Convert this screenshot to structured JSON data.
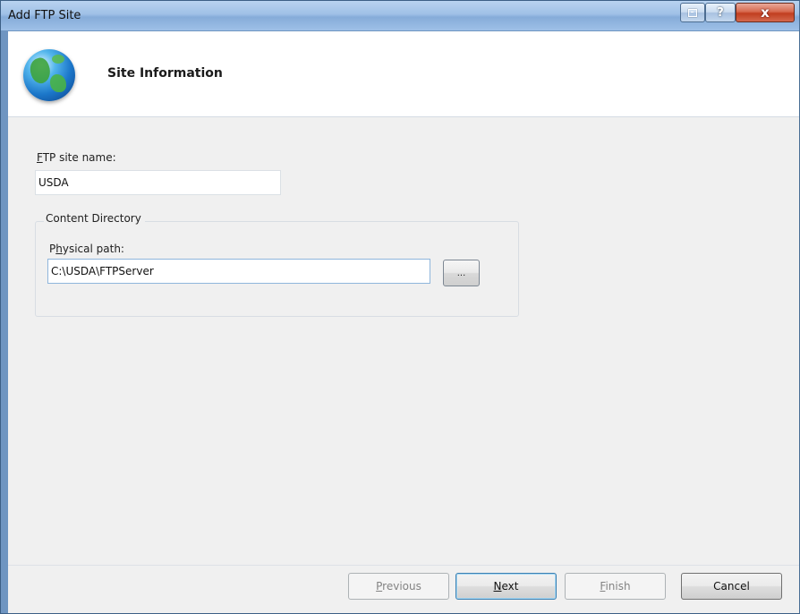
{
  "window": {
    "title": "Add FTP Site",
    "controls": {
      "restore_icon": "restore-icon",
      "help_glyph": "?",
      "close_glyph": "x"
    }
  },
  "header": {
    "title": "Site Information",
    "icon": "globe-icon"
  },
  "form": {
    "site_name": {
      "label_mnemonic": "F",
      "label_rest": "TP site name:",
      "value": "USDA"
    },
    "content_directory": {
      "legend": "Content Directory",
      "physical_path": {
        "label_pre": "P",
        "label_mnemonic": "h",
        "label_rest": "ysical path:",
        "value": "C:\\USDA\\FTPServer",
        "browse_label": "..."
      }
    }
  },
  "footer": {
    "previous": {
      "mnemonic": "P",
      "rest": "revious",
      "enabled": false
    },
    "next": {
      "mnemonic": "N",
      "rest": "ext",
      "enabled": true
    },
    "finish": {
      "mnemonic": "F",
      "rest": "inish",
      "enabled": false
    },
    "cancel": {
      "label": "Cancel",
      "enabled": true
    }
  },
  "colors": {
    "titlebar": "#9fc0e6",
    "close_button": "#c13e1f",
    "dialog_body": "#f0f0f0",
    "header_bg": "#ffffff"
  }
}
